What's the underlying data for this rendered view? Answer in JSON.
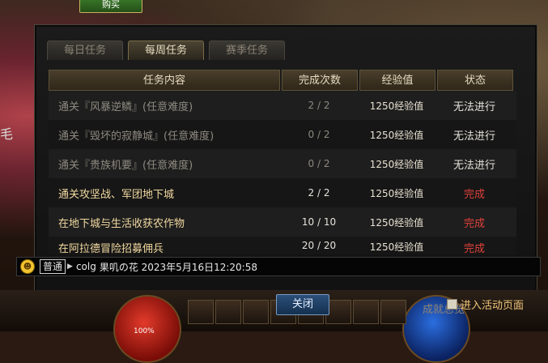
{
  "top_button_label": "购买",
  "side_text": "毛",
  "tabs": [
    {
      "label": "每日任务",
      "active": false
    },
    {
      "label": "每周任务",
      "active": true
    },
    {
      "label": "赛季任务",
      "active": false
    }
  ],
  "table": {
    "headers": [
      "任务内容",
      "完成次数",
      "经验值",
      "状态"
    ],
    "rows": [
      {
        "task": "通关『风暴逆鳞』(任意难度)",
        "count": "2 / 2",
        "exp": "1250经验值",
        "status": "无法进行"
      },
      {
        "task": "通关『毁坏的寂静城』(任意难度)",
        "count": "0 / 2",
        "exp": "1250经验值",
        "status": "无法进行"
      },
      {
        "task": "通关『贵族机要』(任意难度)",
        "count": "0 / 2",
        "exp": "1250经验值",
        "status": "无法进行"
      },
      {
        "task": "通关攻坚战、军团地下城",
        "count": "2 / 2",
        "exp": "1250经验值",
        "status": "完成"
      },
      {
        "task": "在地下城与生活收获农作物",
        "count": "10 / 10",
        "exp": "1250经验值",
        "status": "完成"
      },
      {
        "task": "在阿拉德冒险招募佣兵",
        "count": "20 / 20",
        "exp": "1250经验值",
        "status": "完成"
      }
    ]
  },
  "chat": {
    "channel": "普通",
    "user": "colg",
    "message": "果叽の花 2023年5月16日12:20:58"
  },
  "close_label": "关闭",
  "achievement_label": "成就总览",
  "activity_label": "进入活动页面",
  "hp_label": "100%"
}
